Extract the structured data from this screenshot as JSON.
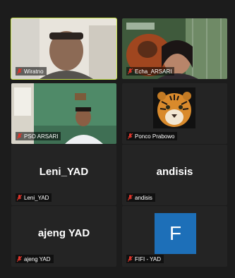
{
  "participants": [
    {
      "name": "Wiratno"
    },
    {
      "name": "Echa_ARSARI"
    },
    {
      "name": "PSO ARSARI"
    },
    {
      "name": "Ponco Prabowo"
    },
    {
      "name": "Leni_YAD",
      "display": "Leni_YAD"
    },
    {
      "name": "andisis",
      "display": "andisis"
    },
    {
      "name": "ajeng YAD",
      "display": "ajeng YAD"
    },
    {
      "name": "FIFI - YAD",
      "avatar_letter": "F"
    }
  ],
  "colors": {
    "active_speaker": "#c8e34a",
    "muted_icon": "#e0352b",
    "avatar_bg": "#1d6fb8"
  },
  "icons": {
    "mute": "mic-muted-icon"
  }
}
